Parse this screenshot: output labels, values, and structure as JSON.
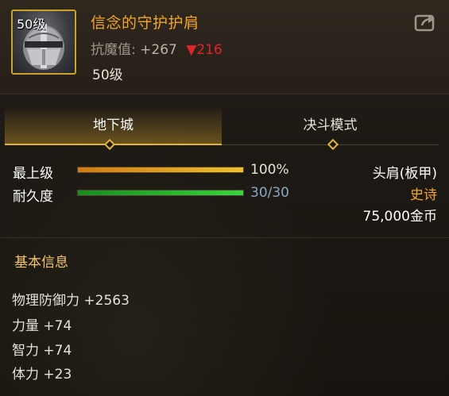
{
  "item": {
    "level_badge": "50级",
    "name": "信念的守护护肩",
    "stat_label": "抗魔值:",
    "stat_plus": "+267",
    "stat_down": "▼216",
    "required_level": "50级",
    "icon": "knight-helmet-icon"
  },
  "tabs": [
    {
      "label": "地下城",
      "active": true
    },
    {
      "label": "决斗模式",
      "active": false
    }
  ],
  "bars": {
    "max_level": {
      "label": "最上级",
      "value_text": "100%",
      "fraction": 1.0
    },
    "durability": {
      "label": "耐久度",
      "value_text": "30/30",
      "fraction": 1.0
    }
  },
  "info": {
    "slot": "头肩(板甲)",
    "rarity": "史诗",
    "price": "75,000金币"
  },
  "basic_info": {
    "title": "基本信息",
    "attributes": [
      "物理防御力 +2563",
      "力量 +74",
      "智力 +74",
      "体力 +23"
    ]
  },
  "colors": {
    "accent_gold": "#e4b43a",
    "name_orange": "#f5a623",
    "down_red": "#e0242a",
    "durability_blue": "#8aa8c4"
  }
}
